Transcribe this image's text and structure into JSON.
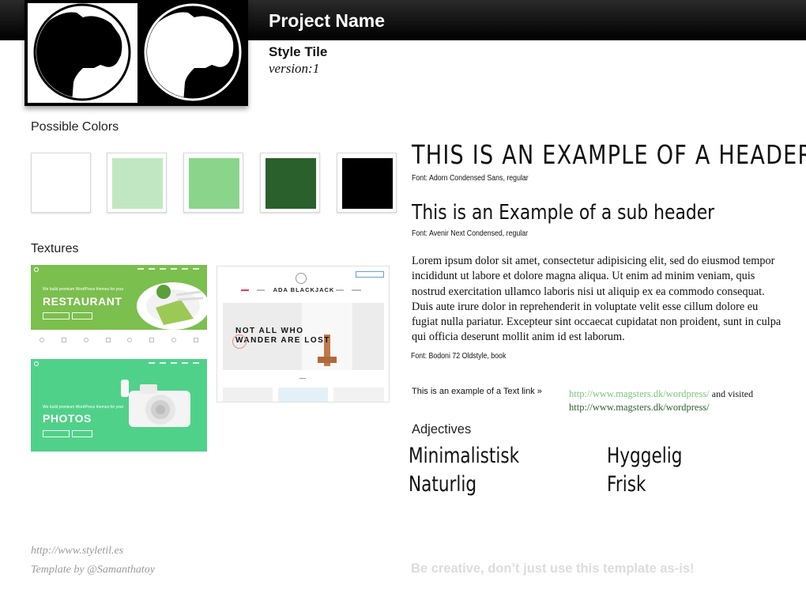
{
  "header": {
    "project_name": "Project Name",
    "tile_title": "Style Tile",
    "version": "version:1"
  },
  "colors": {
    "label": "Possible Colors",
    "swatches": [
      "#ffffff",
      "#c1e7c2",
      "#8ad58b",
      "#2a602c",
      "#000000"
    ]
  },
  "textures": {
    "label": "Textures",
    "restaurant": {
      "tagline": "We build premium WordPress themes for your",
      "title": "RESTAURANT"
    },
    "photos": {
      "tagline": "We build premium WordPress themes for your",
      "title": "PHOTOS"
    },
    "ada": {
      "brand": "ADA BLACKJACK",
      "headline_1": "NOT ALL WHO",
      "headline_2": "WANDER ARE LOST"
    }
  },
  "typography": {
    "header_example": "THIS IS AN EXAMPLE OF A HEADER",
    "header_font": "Font: Adorn Condensed Sans, regular",
    "subheader_example": "This is an Example of a sub header",
    "subheader_font": "Font: Avenir Next Condensed, regular",
    "body": "Lorem ipsum dolor sit amet, consectetur adipisicing elit, sed do eiusmod tempor incididunt ut labore et dolore magna aliqua. Ut enim ad minim veniam, quis nostrud exercitation ullamco laboris nisi ut aliquip ex ea commodo consequat. Duis aute irure dolor in reprehenderit in voluptate velit esse cillum dolore eu fugiat nulla pariatur. Excepteur sint occaecat cupidatat non proident, sunt in culpa qui officia deserunt mollit anim id est laborum.",
    "body_font": "Font: Bodoni 72 Oldstyle, book"
  },
  "links": {
    "label": "This is an example of a Text link »",
    "link": "http://www.magsters.dk/wordpress/",
    "and_visited": "and visited",
    "visited_link": "http://www.magsters.dk/wordpress/",
    "link_color": "#7cc47c",
    "visited_color": "#2c5f2e"
  },
  "adjectives": {
    "label": "Adjectives",
    "items": [
      "Minimalistisk",
      "Hyggelig",
      "Naturlig",
      "Frisk"
    ]
  },
  "footer": {
    "site": "http://www.styletil.es",
    "credit": "Template by @Samanthatoy",
    "note": "Be creative, don’t just use this template as-is!"
  }
}
